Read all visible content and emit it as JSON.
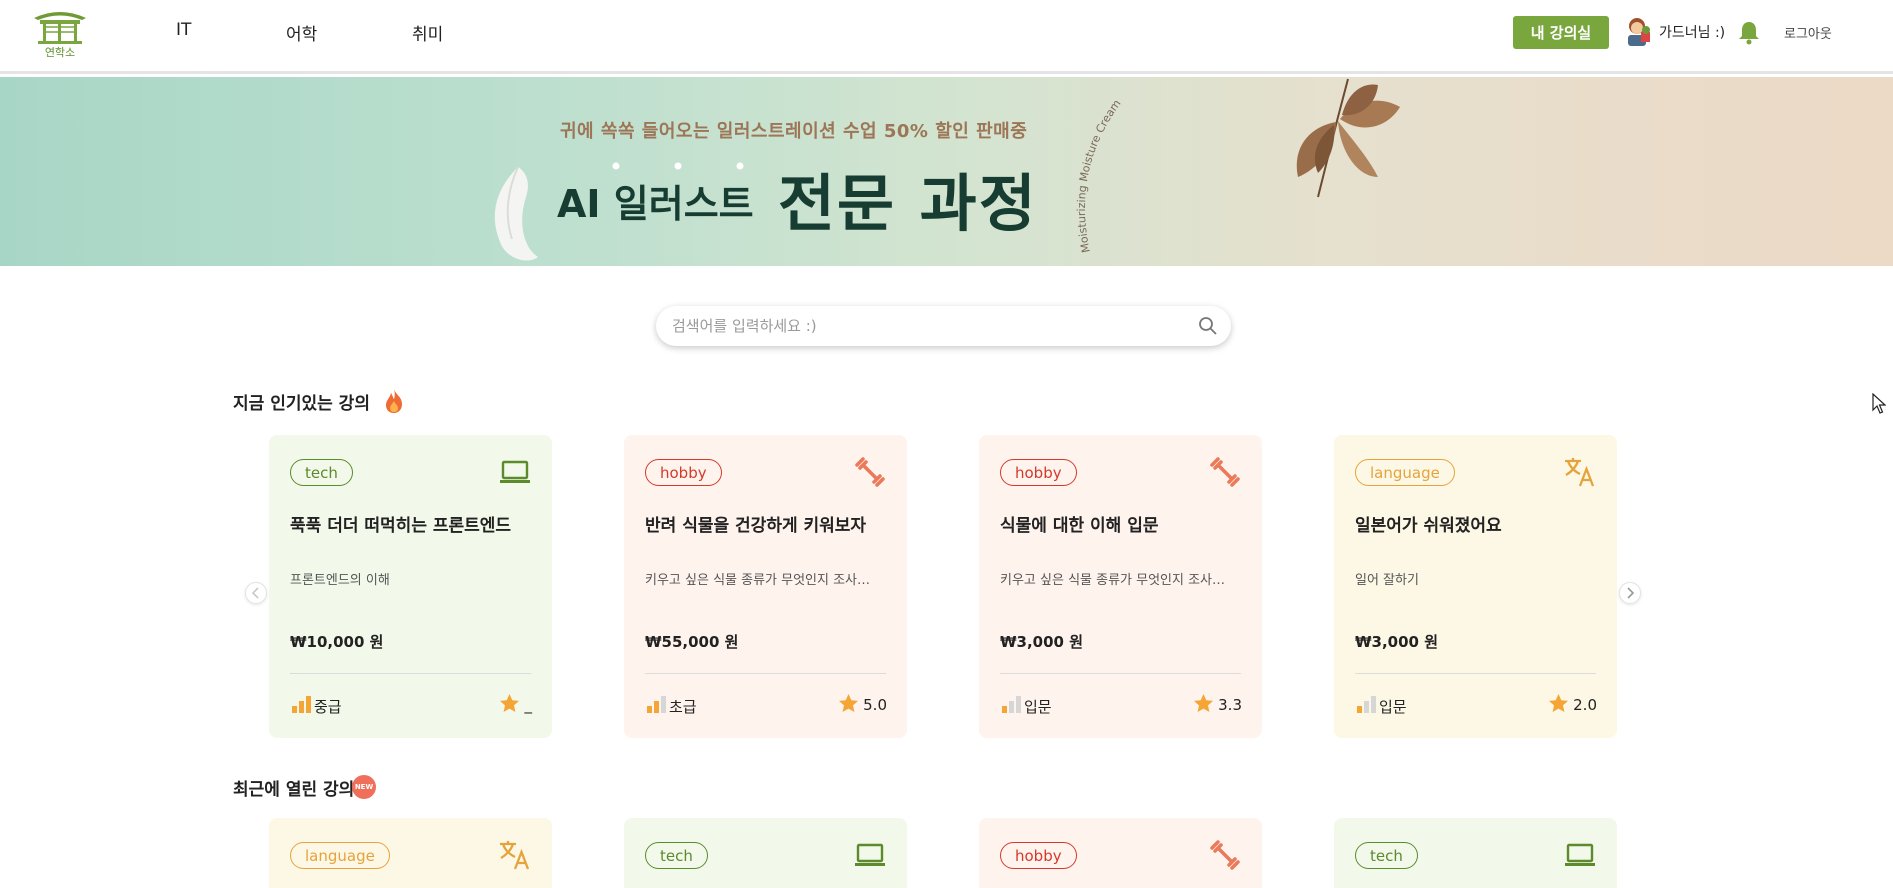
{
  "header": {
    "logo_text": "연학소",
    "nav": [
      "IT",
      "어학",
      "취미"
    ],
    "my_class_label": "내 강의실",
    "user_name": "가드너님 :)",
    "logout_label": "로그아웃"
  },
  "banner": {
    "subtitle": "귀에 쏙쏙 들어오는 일러스트레이션 수업  50% 할인 판매중",
    "title_light": "AI 일러스트",
    "title_bold": "전문 과정",
    "curve_text": "Moisturizing Moisture Cream"
  },
  "search": {
    "placeholder": "검색어를 입력하세요 :)",
    "icon": "search-icon"
  },
  "sections": {
    "popular_title": "지금 인기있는 강의",
    "recent_title": "최근에 열린 강의",
    "new_badge": "NEW"
  },
  "colors": {
    "accent": "#7aa63e",
    "tech": "#5c8a2c",
    "hobby": "#d43a2b",
    "language": "#e6a33c",
    "star": "#f5a535"
  },
  "popular_courses": [
    {
      "category": "tech",
      "icon": "laptop-icon",
      "title": "푹푹 더더 떠먹히는 프론트엔드",
      "description": "프론트엔드의 이해",
      "price": "₩10,000 원",
      "level": "중급",
      "level_bars": 3,
      "rating": "_"
    },
    {
      "category": "hobby",
      "icon": "dumbbell-icon",
      "title": "반려 식물을 건강하게 키워보자",
      "description": "키우고 싶은 식물 종류가 무엇인지 조사…",
      "price": "₩55,000 원",
      "level": "초급",
      "level_bars": 2,
      "rating": "5.0"
    },
    {
      "category": "hobby",
      "icon": "dumbbell-icon",
      "title": "식물에 대한 이해 입문",
      "description": "키우고 싶은 식물 종류가 무엇인지 조사…",
      "price": "₩3,000 원",
      "level": "입문",
      "level_bars": 1,
      "rating": "3.3"
    },
    {
      "category": "language",
      "icon": "translate-icon",
      "title": "일본어가 쉬워졌어요",
      "description": "일어 잘하기",
      "price": "₩3,000 원",
      "level": "입문",
      "level_bars": 1,
      "rating": "2.0"
    }
  ],
  "recent_courses": [
    {
      "category": "language",
      "icon": "translate-icon"
    },
    {
      "category": "tech",
      "icon": "laptop-icon"
    },
    {
      "category": "hobby",
      "icon": "dumbbell-icon"
    },
    {
      "category": "tech",
      "icon": "laptop-icon"
    }
  ]
}
